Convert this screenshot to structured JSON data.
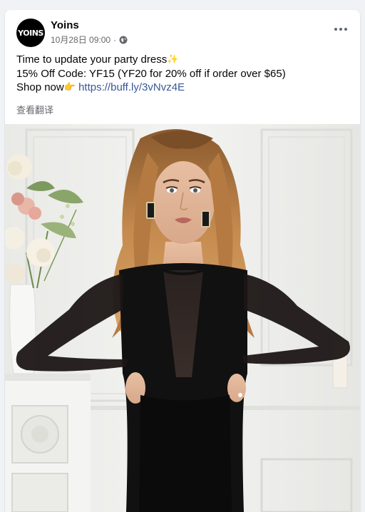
{
  "post": {
    "page_name": "Yoins",
    "avatar_text": "YOINS",
    "date": "10月28日 09:00",
    "separator": "·",
    "privacy_icon": "globe-icon",
    "more_icon": "more-horizontal-icon",
    "lines": {
      "line1_text": "Time to update your party dress",
      "line1_emoji": "✨",
      "line2_text": "15% Off Code: YF15 (YF20 for 20% off if order over $65)",
      "line3_text": "Shop now",
      "line3_emoji": "👉",
      "link": "https://buff.ly/3vNvz4E"
    },
    "translate_label": "查看翻译",
    "photo_icon": "photo-model-black-mesh-dress"
  },
  "colors": {
    "link": "#385898",
    "meta": "#65676b",
    "background": "#f0f2f5",
    "card": "#ffffff"
  }
}
